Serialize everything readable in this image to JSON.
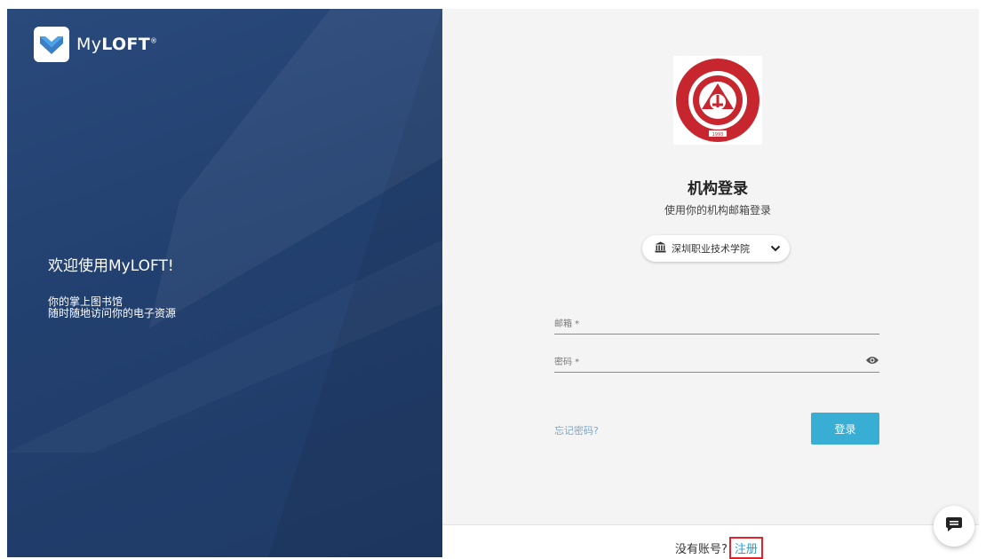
{
  "brand": {
    "name_prefix": "My",
    "name_suffix": "LOFT",
    "mark": "®"
  },
  "hero": {
    "welcome": "欢迎使用MyLOFT!",
    "tagline_line1": "你的掌上图书馆",
    "tagline_line2": "随时随地访问你的电子资源"
  },
  "emblem": {
    "year": "1993",
    "text_top": "深圳职业技术学院",
    "text_bottom": "SHENZHEN POLYTECHNIC"
  },
  "login": {
    "title": "机构登录",
    "subtitle": "使用你的机构邮箱登录",
    "institution_icon": "institution-icon",
    "institution": "深圳职业技术学院",
    "email_label": "邮箱 *",
    "password_label": "密码 *",
    "forgot_label": "忘记密码?",
    "submit_label": "登录"
  },
  "footer": {
    "prompt": "没有账号?",
    "signup_label": "注册"
  },
  "colors": {
    "hero_bg": "#22406f",
    "accent": "#39aed4",
    "link": "#2a9bd0",
    "highlight_box": "#e0242b"
  }
}
